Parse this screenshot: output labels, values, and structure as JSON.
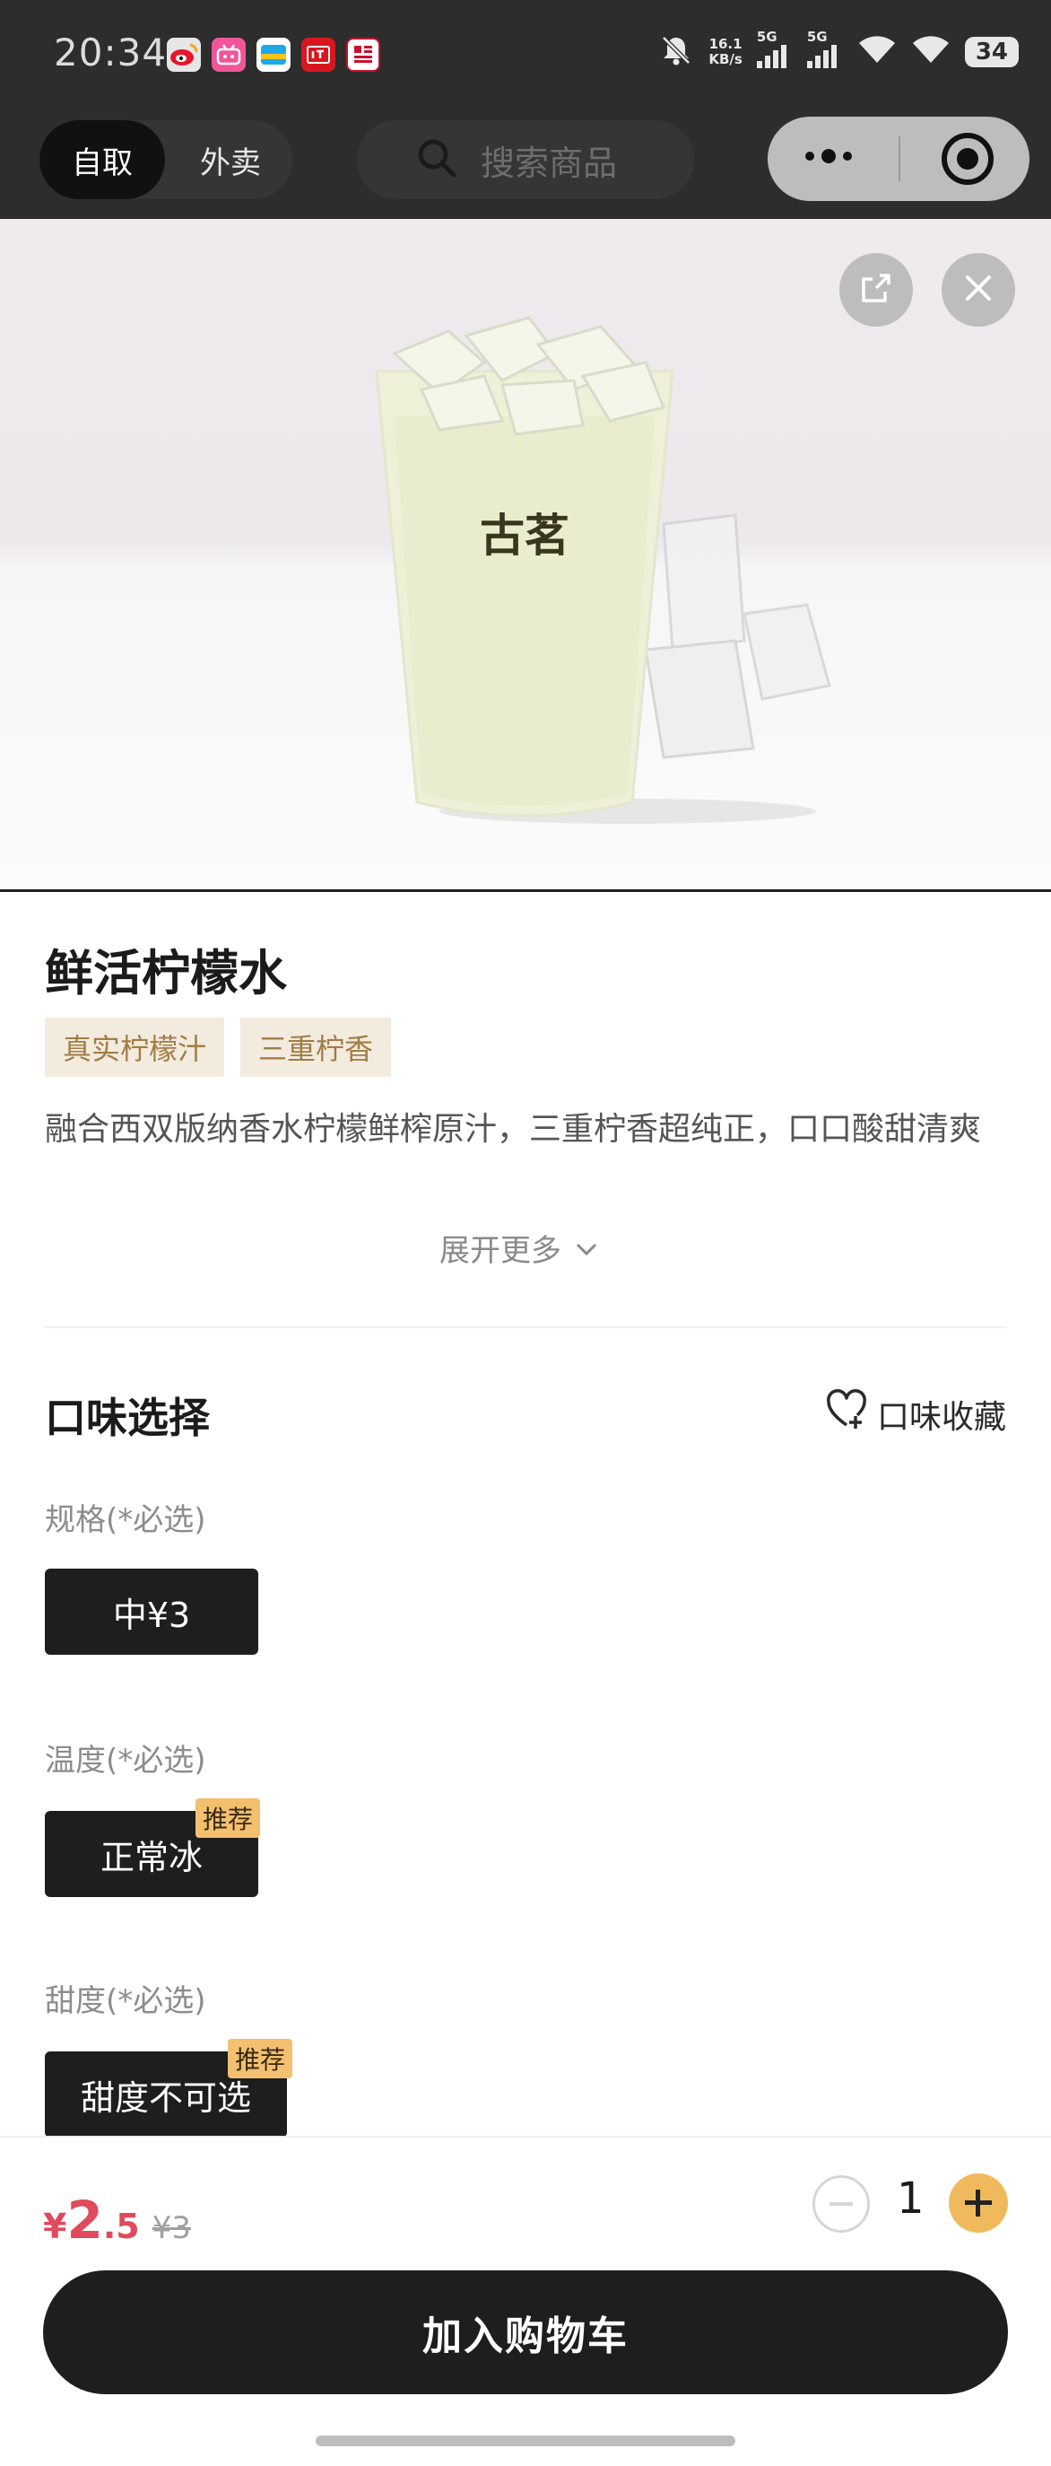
{
  "status_bar": {
    "time": "20:34",
    "net_speed_value": "16.1",
    "net_speed_unit": "KB/s",
    "signal_1": "5G",
    "signal_2": "5G",
    "battery": "34"
  },
  "nav": {
    "mode_active": "自取",
    "mode_inactive": "外卖",
    "search_placeholder": "搜索商品"
  },
  "product": {
    "image_cup_text": "古茗",
    "title": "鲜活柠檬水",
    "tags": [
      "真实柠檬汁",
      "三重柠香"
    ],
    "description": "融合西双版纳香水柠檬鲜榨原汁，三重柠香超纯正，口口酸甜清爽",
    "expand_label": "展开更多"
  },
  "options": {
    "section_title": "口味选择",
    "favorite_label": "口味收藏",
    "groups": [
      {
        "label": "规格(*必选)",
        "selected": "中¥3"
      },
      {
        "label": "温度(*必选)",
        "selected": "正常冰",
        "badge": "推荐"
      },
      {
        "label": "甜度(*必选)",
        "selected": "甜度不可选",
        "badge": "推荐"
      }
    ]
  },
  "footer": {
    "currency": "¥",
    "price_int": "2",
    "price_dec": ".5",
    "original_price": "¥3",
    "quantity": "1",
    "cart_button": "加入购物车"
  },
  "colors": {
    "accent_price": "#e04a5a",
    "plus_button": "#f0b95c",
    "tag_bg": "#f2ebde",
    "tag_text": "#a27d45",
    "badge_bg": "#f3c070"
  }
}
